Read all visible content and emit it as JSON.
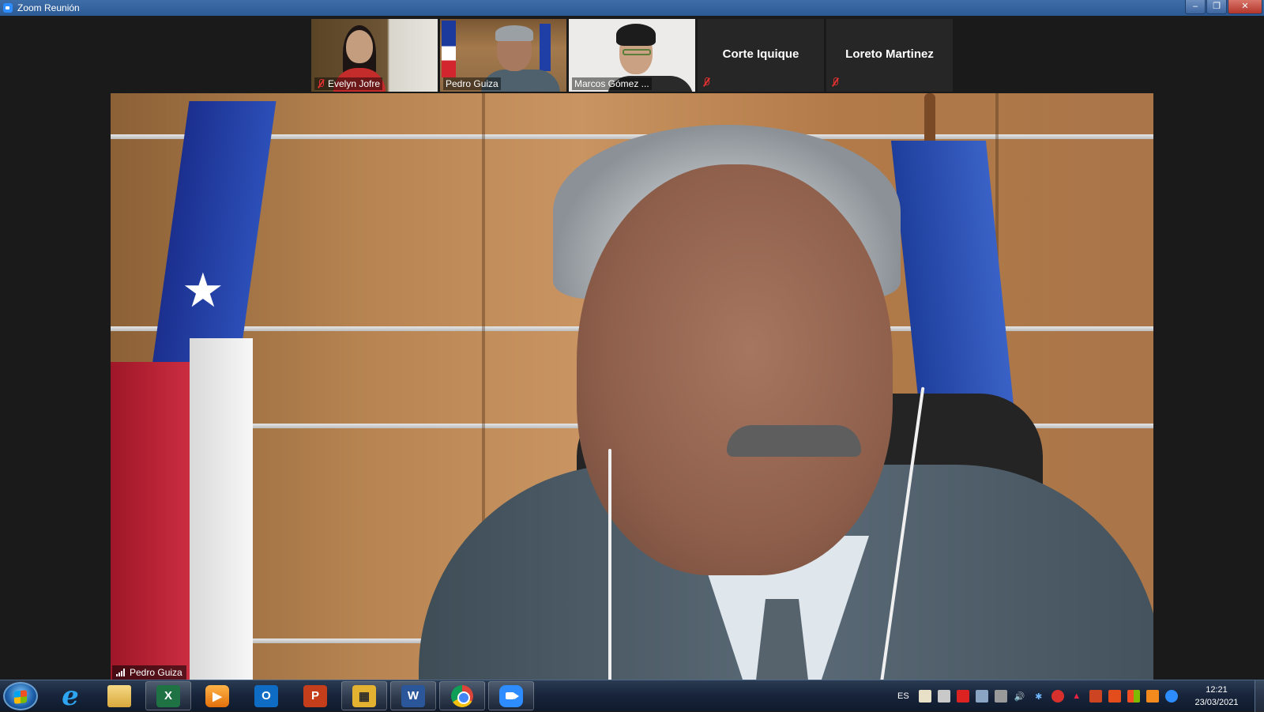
{
  "window": {
    "title": "Zoom Reunión",
    "minimize": "–",
    "restore": "❐",
    "close": "✕"
  },
  "participants": [
    {
      "name": "Evelyn Jofre",
      "muted": true,
      "video": true
    },
    {
      "name": "Pedro Guiza",
      "muted": false,
      "video": true,
      "active_speaker": true
    },
    {
      "name": "Marcos Gómez ...",
      "muted": false,
      "video": true
    },
    {
      "name": "Corte Iquique",
      "muted": true,
      "video": false
    },
    {
      "name": "Loreto Martinez",
      "muted": true,
      "video": false
    }
  ],
  "main_video": {
    "speaker_name": "Pedro Guiza"
  },
  "taskbar": {
    "apps": [
      {
        "name": "internet-explorer",
        "glyph": "e"
      },
      {
        "name": "file-explorer",
        "glyph": ""
      },
      {
        "name": "excel",
        "glyph": "X"
      },
      {
        "name": "media-player",
        "glyph": "▶"
      },
      {
        "name": "outlook",
        "glyph": "O"
      },
      {
        "name": "powerpoint",
        "glyph": "P"
      },
      {
        "name": "project-app",
        "glyph": "▦"
      },
      {
        "name": "word",
        "glyph": "W"
      },
      {
        "name": "chrome",
        "glyph": ""
      },
      {
        "name": "zoom",
        "glyph": ""
      }
    ],
    "language": "ES",
    "time": "12:21",
    "date": "23/03/2021"
  }
}
